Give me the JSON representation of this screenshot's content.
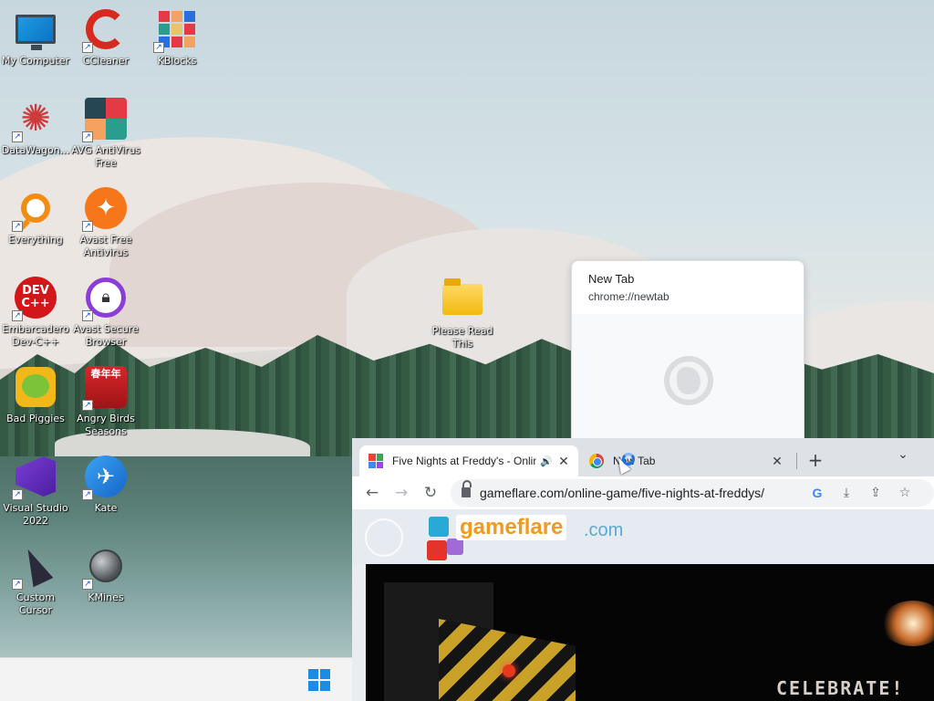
{
  "desktop": {
    "icons": [
      {
        "label": "My Computer",
        "icon": "monitor-icon"
      },
      {
        "label": "CCleaner",
        "icon": "ccleaner-icon"
      },
      {
        "label": "KBlocks",
        "icon": "kblocks-icon"
      },
      {
        "label": "DataWagon...",
        "icon": "datawagon-icon"
      },
      {
        "label": "AVG AntiVirus Free",
        "icon": "avg-icon"
      },
      {
        "label": "Everything",
        "icon": "everything-icon"
      },
      {
        "label": "Avast Free Antivirus",
        "icon": "avast-icon"
      },
      {
        "label": "Embarcadero Dev-C++",
        "icon": "devcpp-icon"
      },
      {
        "label": "Avast Secure Browser",
        "icon": "avast-browser-icon"
      },
      {
        "label": "Bad Piggies",
        "icon": "bad-piggies-icon"
      },
      {
        "label": "Angry Birds Seasons",
        "icon": "angry-birds-icon"
      },
      {
        "label": "Visual Studio 2022",
        "icon": "visual-studio-icon"
      },
      {
        "label": "Kate",
        "icon": "kate-icon"
      },
      {
        "label": "Custom Cursor",
        "icon": "custom-cursor-icon"
      },
      {
        "label": "KMines",
        "icon": "kmines-icon"
      },
      {
        "label": "Please Read This",
        "icon": "folder-icon"
      }
    ],
    "dev_text": "DEV C++",
    "angry_text": "春年年"
  },
  "hover_card": {
    "title": "New Tab",
    "url": "chrome://newtab"
  },
  "browser": {
    "tabs": [
      {
        "title": "Five Nights at Freddy's - Online",
        "active": true,
        "audio": "🔊",
        "close": "✕"
      },
      {
        "title": "New Tab",
        "active": false,
        "close": "✕"
      }
    ],
    "new_tab": "+",
    "tab_search": "⌄",
    "back": "←",
    "forward": "→",
    "reload": "↻",
    "url": "gameflare.com/online-game/five-nights-at-freddys/",
    "google_g": "G",
    "install": "⤓",
    "share": "⇪",
    "bookmark": "☆"
  },
  "page": {
    "logo_word": "gameflare",
    "logo_tld": ".com",
    "game_text": "CELEBRATE!"
  },
  "colors": {
    "accent": "#1a73e8",
    "logo_orange": "#f39a1e",
    "logo_blue": "#5aa9d6",
    "start_blue": "#1b8ce6"
  }
}
